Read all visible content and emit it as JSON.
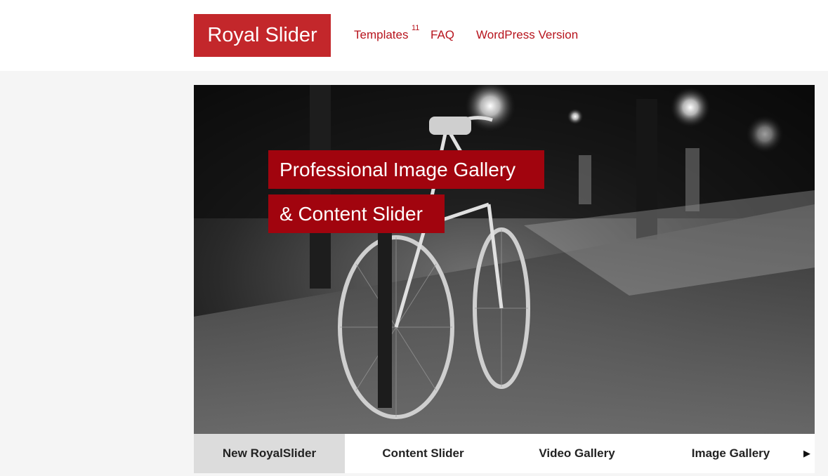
{
  "header": {
    "logo": "Royal Slider",
    "nav": [
      {
        "label": "Templates"
      },
      {
        "label": "FAQ"
      },
      {
        "label": "WordPress Version"
      }
    ],
    "templates_badge": "11"
  },
  "slider": {
    "captions": [
      "Professional Image Gallery",
      "& Content Slider"
    ],
    "thumbnails": [
      {
        "label": "New RoyalSlider",
        "active": true
      },
      {
        "label": "Content Slider",
        "active": false
      },
      {
        "label": "Video Gallery",
        "active": false
      },
      {
        "label": "Image Gallery",
        "active": false
      }
    ],
    "next_arrow": "▶"
  },
  "colors": {
    "brand_red": "#c3272b",
    "caption_red": "#a1040e",
    "link_red": "#b7141d"
  }
}
